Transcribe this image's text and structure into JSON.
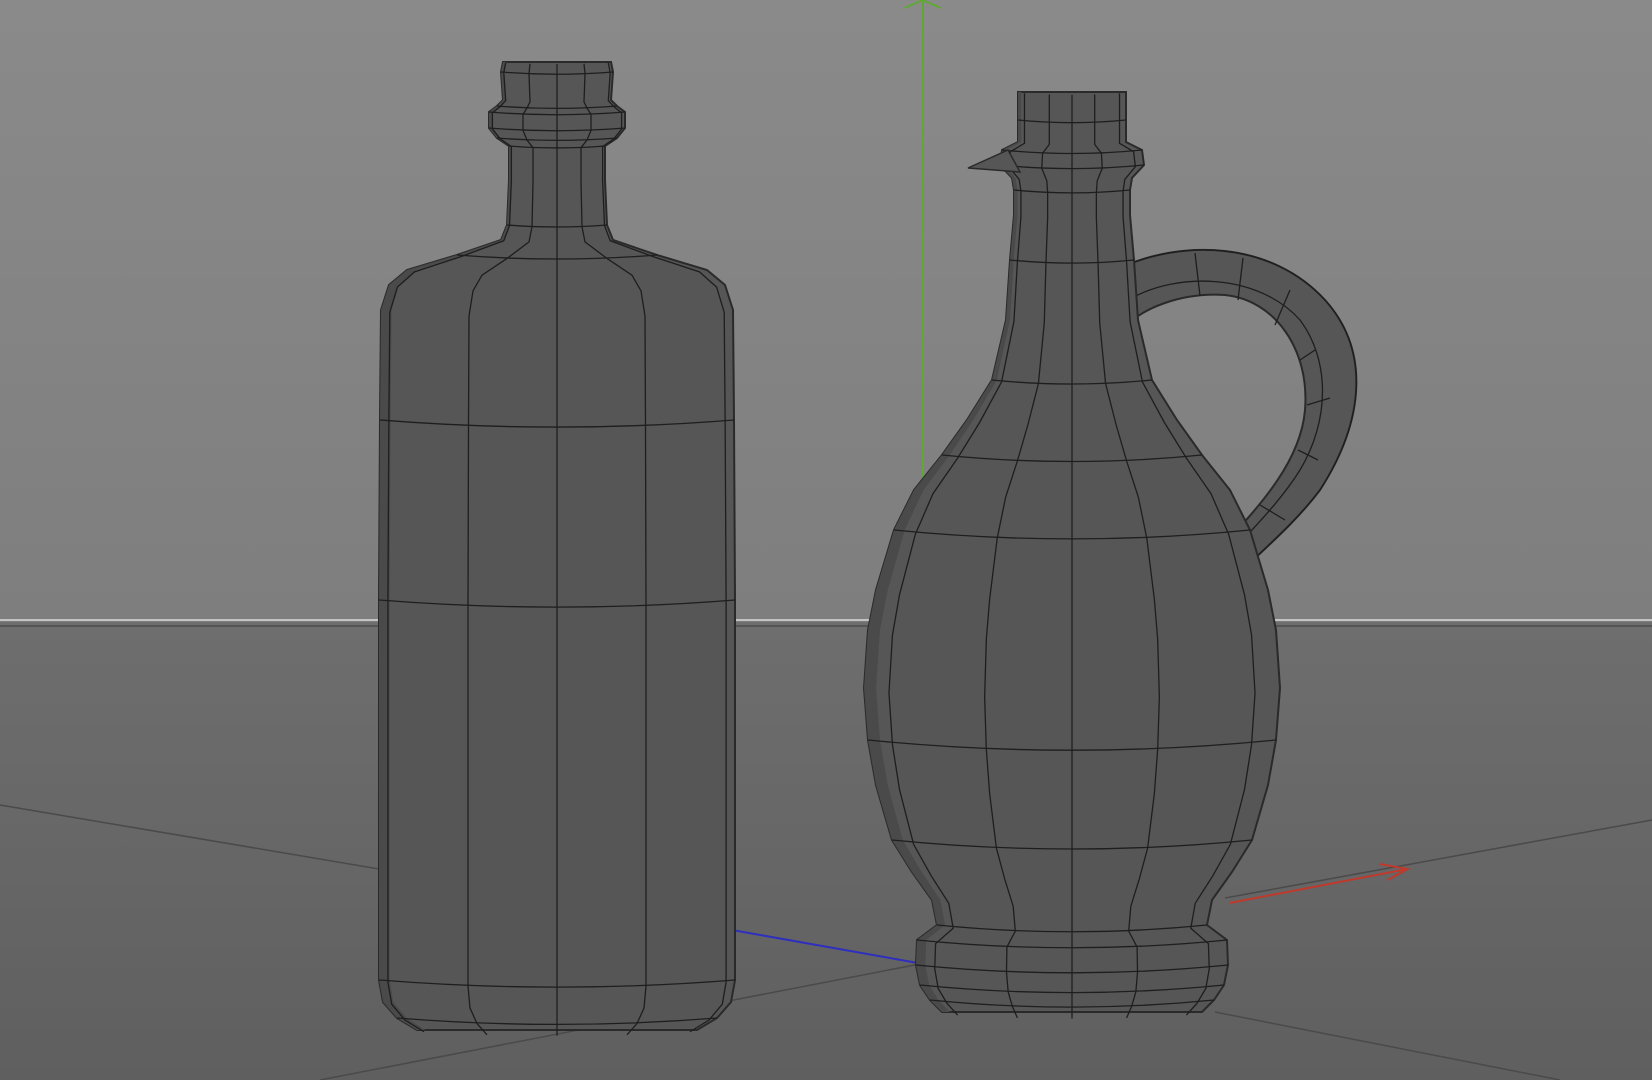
{
  "viewport": {
    "background_top": "#8a8a8a",
    "background_horizon": "#7e7e7e",
    "floor_top": "#6e6e6e",
    "floor_bottom": "#5f5f5f",
    "horizon_line": "#b8b8b8",
    "floor_grid_line": "#4c4c4c"
  },
  "axes": {
    "x_color": "#c0392b",
    "y_color": "#5fa832",
    "z_color": "#2e2ebf"
  },
  "objects": [
    {
      "name": "Bottle",
      "type": "cylindrical-bottle"
    },
    {
      "name": "Jug",
      "type": "handled-jug"
    }
  ],
  "mesh_style": {
    "fill": "#565656",
    "edge_shade": "#4a4a4a",
    "wire": "#1e1e1e",
    "outline": "#2a2a2a"
  }
}
